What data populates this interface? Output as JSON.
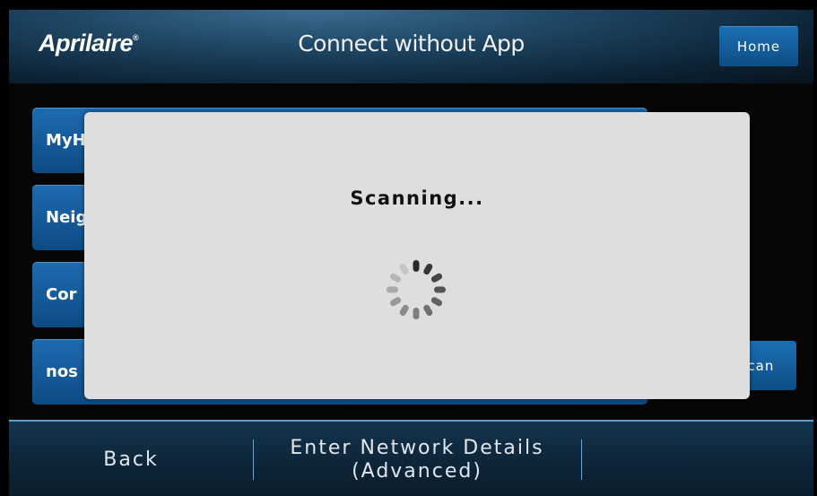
{
  "header": {
    "brand": "Aprilaire",
    "brand_mark": "®",
    "title": "Connect without App",
    "home_label": "Home"
  },
  "networks": [
    {
      "label": "MyH"
    },
    {
      "label": "Neig"
    },
    {
      "label": "Cor"
    },
    {
      "label": "nos"
    }
  ],
  "rescan_label": "scan",
  "modal": {
    "text": "Scanning...",
    "icon": "loading-spinner-icon"
  },
  "footer": {
    "back_label": "Back",
    "advanced_line1": "Enter Network Details",
    "advanced_line2": "(Advanced)"
  },
  "colors": {
    "button_blue": "#1565a8",
    "modal_bg": "#dedede",
    "accent_line": "#5fa0cf"
  }
}
